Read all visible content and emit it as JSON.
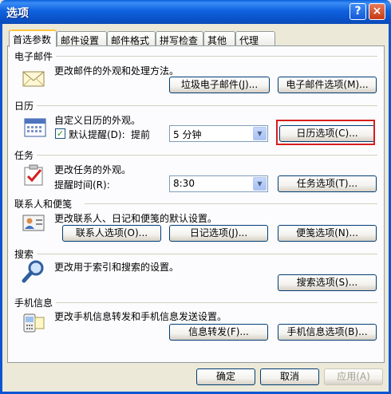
{
  "window": {
    "title": "选项",
    "help_label": "?",
    "close_label": "×"
  },
  "tabs": [
    {
      "label": "首选参数"
    },
    {
      "label": "邮件设置"
    },
    {
      "label": "邮件格式"
    },
    {
      "label": "拼写检查"
    },
    {
      "label": "其他"
    },
    {
      "label": "代理"
    }
  ],
  "sections": {
    "email": {
      "title": "电子邮件",
      "desc": "更改邮件的外观和处理方法。",
      "buttons": [
        "垃圾电子邮件(J)...",
        "电子邮件选项(M)..."
      ]
    },
    "calendar": {
      "title": "日历",
      "desc": "自定义日历的外观。",
      "reminder_label": "默认提醒(D):",
      "advance_label": "提前",
      "reminder_value": "5 分钟",
      "button": "日历选项(C)..."
    },
    "tasks": {
      "title": "任务",
      "desc": "更改任务的外观。",
      "reminder_time_label": "提醒时间(R):",
      "reminder_time_value": "8:30",
      "button": "任务选项(T)..."
    },
    "contacts": {
      "title": "联系人和便笺",
      "desc": "更改联系人、日记和便笺的默认设置。",
      "buttons": [
        "联系人选项(O)...",
        "日记选项(J)...",
        "便笺选项(N)..."
      ]
    },
    "search": {
      "title": "搜索",
      "desc": "更改用于索引和搜索的设置。",
      "button": "搜索选项(S)..."
    },
    "mobile": {
      "title": "手机信息",
      "desc": "更改手机信息转发和手机信息发送设置。",
      "buttons": [
        "信息转发(F)...",
        "手机信息选项(B)..."
      ]
    }
  },
  "footer": {
    "ok": "确定",
    "cancel": "取消",
    "apply": "应用(A)"
  },
  "colors": {
    "highlight_box": "#D81E1E",
    "titlebar": "#0A52C8"
  }
}
